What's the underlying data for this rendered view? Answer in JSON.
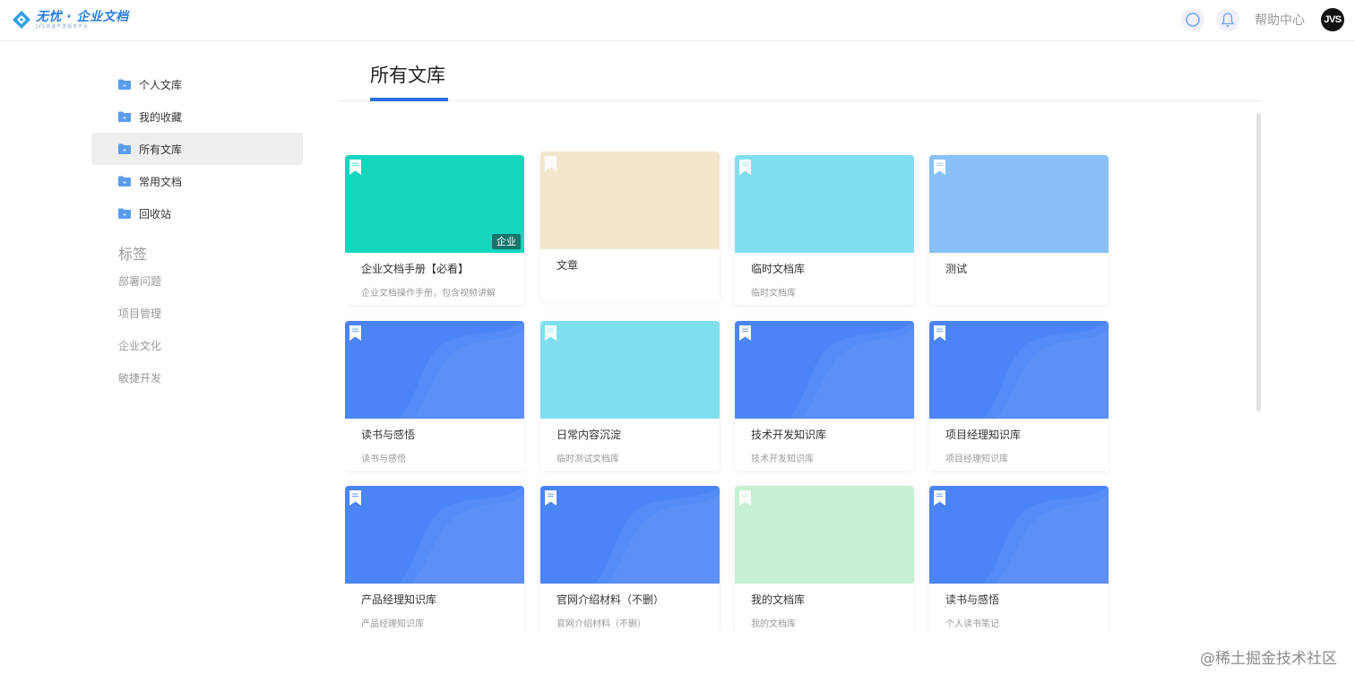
{
  "header": {
    "logo_title": "无忧 · 企业文档",
    "logo_subtitle": "JVS快速开发服务平台",
    "help_label": "帮助中心",
    "avatar_text": "JVS"
  },
  "sidebar": {
    "items": [
      {
        "label": "个人文库",
        "active": false
      },
      {
        "label": "我的收藏",
        "active": false
      },
      {
        "label": "所有文库",
        "active": true
      },
      {
        "label": "常用文档",
        "active": false
      },
      {
        "label": "回收站",
        "active": false
      }
    ],
    "tags_title": "标签",
    "tags": [
      "部署问题",
      "项目管理",
      "企业文化",
      "敏捷开发"
    ]
  },
  "main": {
    "tab_label": "所有文库"
  },
  "cards": [
    {
      "title": "企业文档手册【必看】",
      "desc": "企业文档操作手册，包含视频讲解",
      "color": "#14d6bf",
      "badge": "企业",
      "wave": false
    },
    {
      "title": "文章",
      "desc": "",
      "color": "#f3e6cd",
      "wave": false
    },
    {
      "title": "临时文档库",
      "desc": "临时文档库",
      "color": "#80dfee",
      "wave": false
    },
    {
      "title": "测试",
      "desc": "",
      "color": "#87c1f7",
      "wave": false
    },
    {
      "title": "读书与感悟",
      "desc": "读书与感悟",
      "color": "#4a84f6",
      "wave": true
    },
    {
      "title": "日常内容沉淀",
      "desc": "临时测试文档库",
      "color": "#80dfee",
      "wave": false
    },
    {
      "title": "技术开发知识库",
      "desc": "技术开发知识库",
      "color": "#4a84f6",
      "wave": true
    },
    {
      "title": "项目经理知识库",
      "desc": "项目经理知识库",
      "color": "#4a84f6",
      "wave": true
    },
    {
      "title": "产品经理知识库",
      "desc": "产品经理知识库",
      "color": "#4a84f6",
      "wave": true
    },
    {
      "title": "官网介绍材料（不删）",
      "desc": "官网介绍材料（不删）",
      "color": "#4a84f6",
      "wave": true
    },
    {
      "title": "我的文档库",
      "desc": "我的文档库",
      "color": "#c5f0d3",
      "wave": false
    },
    {
      "title": "读书与感悟",
      "desc": "个人读书笔记",
      "color": "#4a84f6",
      "wave": true
    }
  ],
  "watermark": "@稀土掘金技术社区",
  "colors": {
    "accent": "#2b6fe0",
    "folder": "#5b9cf0"
  }
}
